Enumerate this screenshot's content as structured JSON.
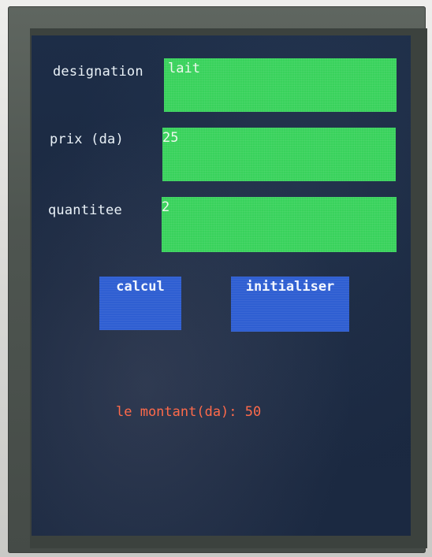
{
  "form": {
    "designation": {
      "label": "designation",
      "value": "lait"
    },
    "prix": {
      "label": "prix (da)",
      "value": "25"
    },
    "quantite": {
      "label": "quantitee",
      "value": "2"
    }
  },
  "buttons": {
    "calcul": "calcul",
    "initialiser": "initialiser"
  },
  "result": {
    "text": "le montant(da): 50"
  },
  "colors": {
    "screen_background": "#1c2b44",
    "field_green": "#39d25c",
    "button_blue": "#2f5fd2",
    "label_text": "#eaf2f8",
    "result_text": "#ff6a4a"
  }
}
